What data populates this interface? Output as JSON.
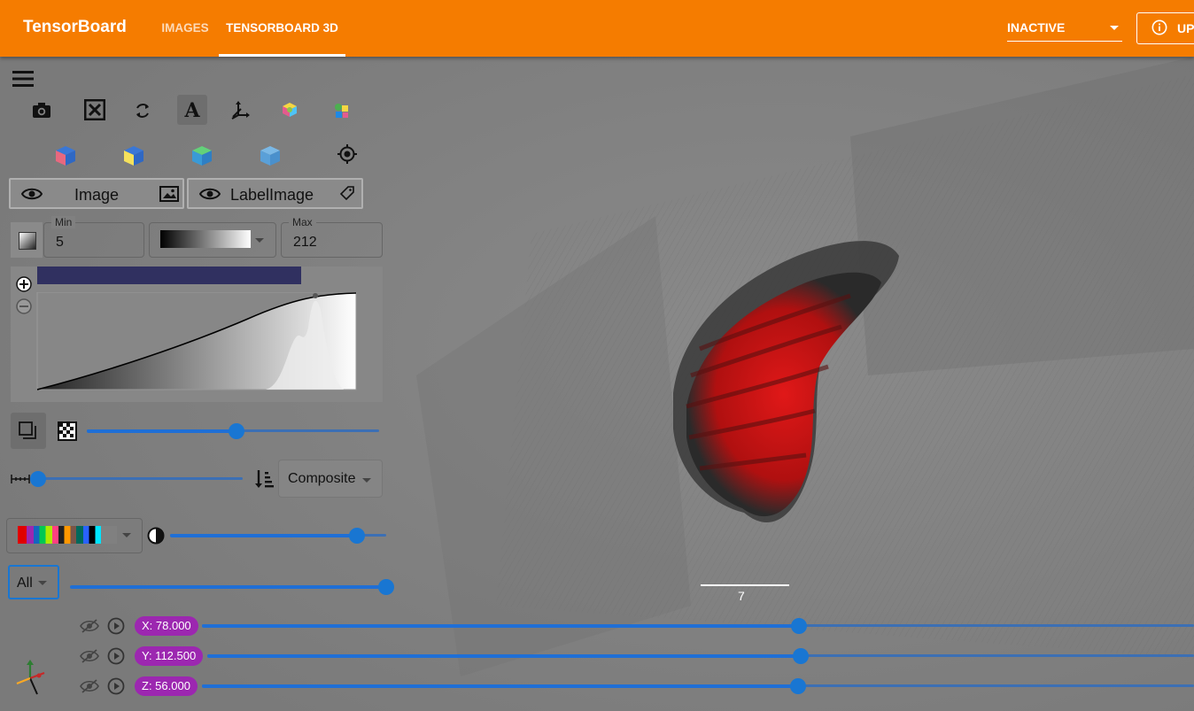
{
  "header": {
    "brand": "TensorBoard",
    "tabs": [
      {
        "label": "IMAGES",
        "active": false
      },
      {
        "label": "TENSORBOARD 3D",
        "active": true
      }
    ],
    "run_select": {
      "value": "INACTIVE"
    },
    "upload_button": {
      "label": "UPLOAD"
    },
    "accent_color": "#f57c00"
  },
  "toolbar": {
    "row1_icons": [
      "menu-icon",
      "camera-icon",
      "fullscreen-icon",
      "rotate-icon",
      "text-annotation-icon",
      "axes-icon",
      "colored-cube-icon",
      "multi-layer-icon"
    ],
    "row2_icons": [
      "view-cube-pink-icon",
      "view-cube-yellow-icon",
      "view-cube-green-icon",
      "view-cube-blue-icon",
      "reset-camera-icon"
    ]
  },
  "layers": [
    {
      "label": "Image",
      "icon": "image-icon"
    },
    {
      "label": "LabelImage",
      "icon": "tag-icon"
    }
  ],
  "contrast": {
    "min_label": "Min",
    "min_value": "5",
    "max_label": "Max",
    "max_value": "212"
  },
  "opacity_slider": {
    "value": 0.5
  },
  "blend": {
    "mode": "Composite",
    "spacing_value": 0.0
  },
  "label_colormap": {
    "contrast_value": 0.87
  },
  "label_selector": {
    "value": "All",
    "opacity_value": 1.0
  },
  "slices": [
    {
      "label": "X: 78.000",
      "fraction": 0.6
    },
    {
      "label": "Y: 112.500",
      "fraction": 0.6
    },
    {
      "label": "Z: 56.000",
      "fraction": 0.6
    }
  ],
  "scale_bar": {
    "label": "7"
  }
}
